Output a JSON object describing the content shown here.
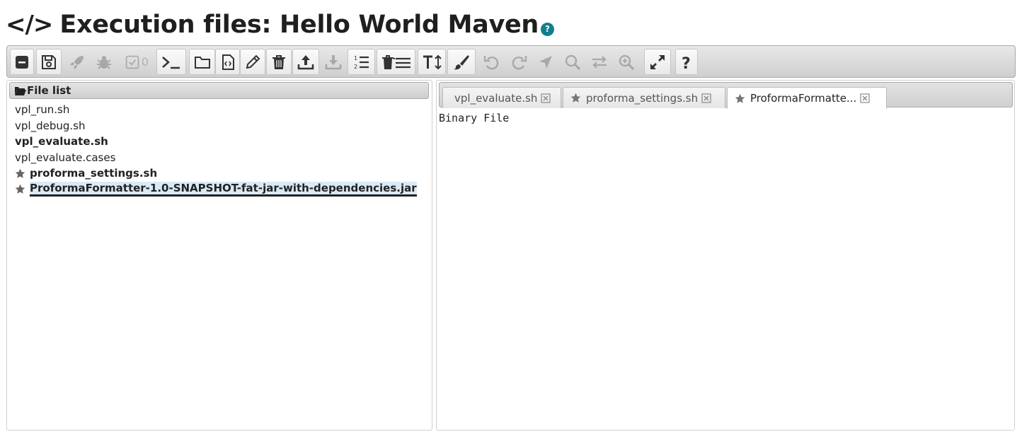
{
  "page": {
    "title": "Execution files: Hello World Maven",
    "code_icon": "</>",
    "help_glyph": "?"
  },
  "toolbar": {
    "buttons": [
      {
        "name": "collapse-button",
        "icon": "minus-square-icon"
      },
      {
        "name": "save-button",
        "icon": "floppy-icon"
      },
      {
        "name": "run-button",
        "icon": "rocket-icon",
        "disabled": true
      },
      {
        "name": "debug-button",
        "icon": "bug-icon",
        "disabled": true
      },
      {
        "name": "evaluate-button",
        "icon": "check-square-icon",
        "disabled": true,
        "count": "0"
      },
      {
        "name": "console-button",
        "icon": "terminal-icon"
      },
      {
        "name": "new-file-button",
        "icon": "folder-icon"
      },
      {
        "name": "file-code-button",
        "icon": "file-code-icon"
      },
      {
        "name": "rename-button",
        "icon": "pencil-icon"
      },
      {
        "name": "delete-button",
        "icon": "trash-icon"
      },
      {
        "name": "upload-button",
        "icon": "upload-icon"
      },
      {
        "name": "download-button",
        "icon": "download-icon",
        "disabled": true
      },
      {
        "name": "line-numbers-button",
        "icon": "numbered-list-icon"
      },
      {
        "name": "delete-all-button",
        "icon": "trash-list-icon"
      },
      {
        "name": "font-size-button",
        "icon": "text-height-icon"
      },
      {
        "name": "theme-button",
        "icon": "brush-icon"
      },
      {
        "name": "undo-button",
        "icon": "undo-icon",
        "disabled": true
      },
      {
        "name": "redo-button",
        "icon": "redo-icon",
        "disabled": true
      },
      {
        "name": "goto-button",
        "icon": "location-arrow-icon",
        "disabled": true
      },
      {
        "name": "find-button",
        "icon": "search-icon",
        "disabled": true
      },
      {
        "name": "replace-button",
        "icon": "exchange-icon",
        "disabled": true
      },
      {
        "name": "find-next-button",
        "icon": "search-plus-icon",
        "disabled": true
      },
      {
        "name": "fullscreen-button",
        "icon": "expand-icon"
      },
      {
        "name": "help-button",
        "icon": "question-icon"
      }
    ]
  },
  "file_list": {
    "header": "File list",
    "files": [
      {
        "name": "vpl_run.sh",
        "bold": false,
        "star": false
      },
      {
        "name": "vpl_debug.sh",
        "bold": false,
        "star": false
      },
      {
        "name": "vpl_evaluate.sh",
        "bold": true,
        "star": false
      },
      {
        "name": "vpl_evaluate.cases",
        "bold": false,
        "star": false
      },
      {
        "name": "proforma_settings.sh",
        "bold": true,
        "star": true
      },
      {
        "name": "ProformaFormatter-1.0-SNAPSHOT-fat-jar-with-dependencies.jar",
        "bold": true,
        "star": true,
        "selected": true
      }
    ]
  },
  "tabs": [
    {
      "label": "vpl_evaluate.sh",
      "star": false,
      "active": false
    },
    {
      "label": "proforma_settings.sh",
      "star": true,
      "active": false
    },
    {
      "label": "ProformaFormatte...",
      "star": true,
      "active": true
    }
  ],
  "editor": {
    "content": "Binary File"
  },
  "colors": {
    "help_badge": "#0f7f8f",
    "selection": "#d8eaf6"
  }
}
